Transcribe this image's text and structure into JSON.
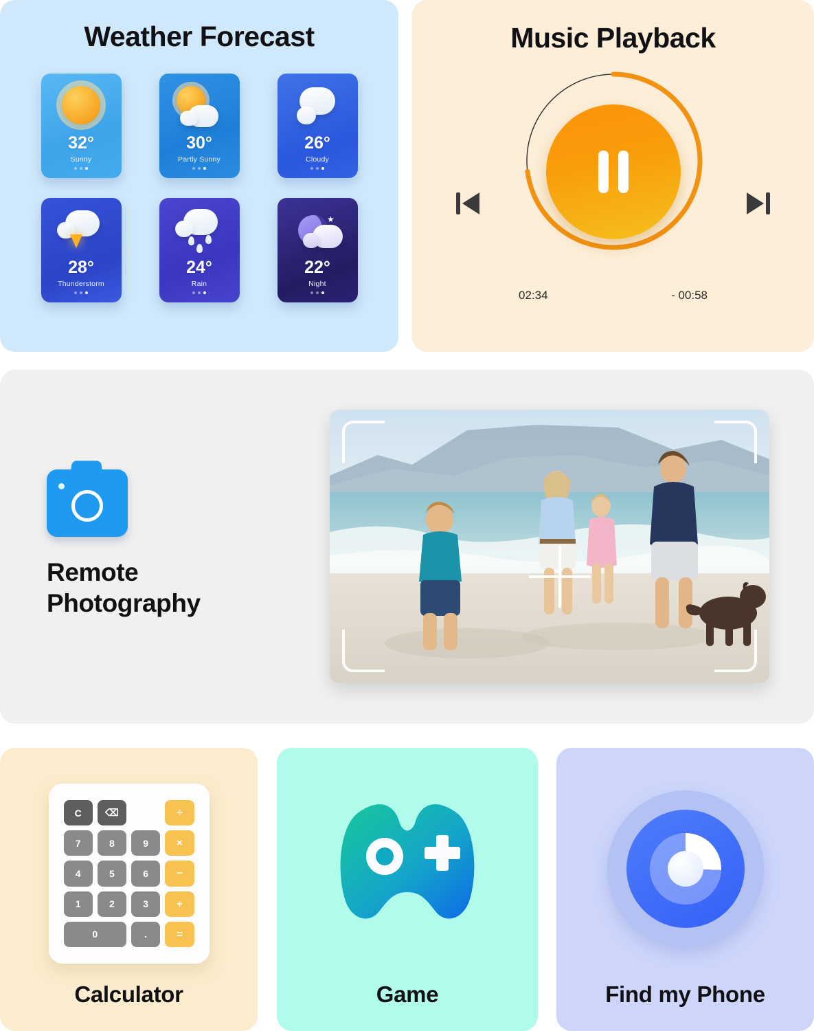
{
  "weather": {
    "title": "Weather Forecast",
    "cards": [
      {
        "temp": "32°",
        "desc": "Sunny",
        "icon": "sun-icon",
        "active_dot": 2
      },
      {
        "temp": "30°",
        "desc": "Partly Sunny",
        "icon": "sun-behind-cloud-icon",
        "active_dot": 2
      },
      {
        "temp": "26°",
        "desc": "Cloudy",
        "icon": "cloud-icon",
        "active_dot": 2
      },
      {
        "temp": "28°",
        "desc": "Thunderstorm",
        "icon": "thunderstorm-icon",
        "active_dot": 2
      },
      {
        "temp": "24°",
        "desc": "Rain",
        "icon": "rain-cloud-icon",
        "active_dot": 2
      },
      {
        "temp": "22°",
        "desc": "Night",
        "icon": "moon-cloud-icon",
        "active_dot": 2
      }
    ],
    "background": "#cfe8fb"
  },
  "music": {
    "title": "Music Playback",
    "play_state": "pause",
    "elapsed": "02:34",
    "remaining": "- 00:58",
    "progress_percent": 73,
    "accent": "#f5a01a",
    "background": "#fceed8",
    "prev_label": "Previous track",
    "next_label": "Next track"
  },
  "photography": {
    "label_line1": "Remote",
    "label_line2": "Photography",
    "icon": "camera-icon",
    "background": "#f0f0f1",
    "preview_alt": "Family running on the beach with a dog"
  },
  "tiles": [
    {
      "label": "Calculator",
      "icon": "calculator-icon",
      "background": "#fbeccd"
    },
    {
      "label": "Game",
      "icon": "gamepad-icon",
      "background": "#b0fbec"
    },
    {
      "label": "Find my Phone",
      "icon": "radar-icon",
      "background": "#cdd6fa"
    }
  ],
  "calculator": {
    "keys": [
      {
        "label": "C",
        "style": "dark",
        "span": 1,
        "name": "clear"
      },
      {
        "label": "⌫",
        "style": "dark",
        "span": 1,
        "name": "backspace"
      },
      {
        "label": "÷",
        "style": "amber",
        "span": 1,
        "name": "divide"
      },
      {
        "label": "7",
        "style": "grey",
        "span": 1,
        "name": "seven"
      },
      {
        "label": "8",
        "style": "grey",
        "span": 1,
        "name": "eight"
      },
      {
        "label": "9",
        "style": "grey",
        "span": 1,
        "name": "nine"
      },
      {
        "label": "×",
        "style": "amber",
        "span": 1,
        "name": "multiply"
      },
      {
        "label": "4",
        "style": "grey",
        "span": 1,
        "name": "four"
      },
      {
        "label": "5",
        "style": "grey",
        "span": 1,
        "name": "five"
      },
      {
        "label": "6",
        "style": "grey",
        "span": 1,
        "name": "six"
      },
      {
        "label": "−",
        "style": "amber",
        "span": 1,
        "name": "minus"
      },
      {
        "label": "1",
        "style": "grey",
        "span": 1,
        "name": "one"
      },
      {
        "label": "2",
        "style": "grey",
        "span": 1,
        "name": "two"
      },
      {
        "label": "3",
        "style": "grey",
        "span": 1,
        "name": "three"
      },
      {
        "label": "+",
        "style": "amber",
        "span": 1,
        "name": "plus"
      },
      {
        "label": "0",
        "style": "grey",
        "span": 2,
        "name": "zero"
      },
      {
        "label": ".",
        "style": "grey",
        "span": 1,
        "name": "decimal"
      },
      {
        "label": "=",
        "style": "amber",
        "span": 1,
        "name": "equals"
      }
    ]
  }
}
